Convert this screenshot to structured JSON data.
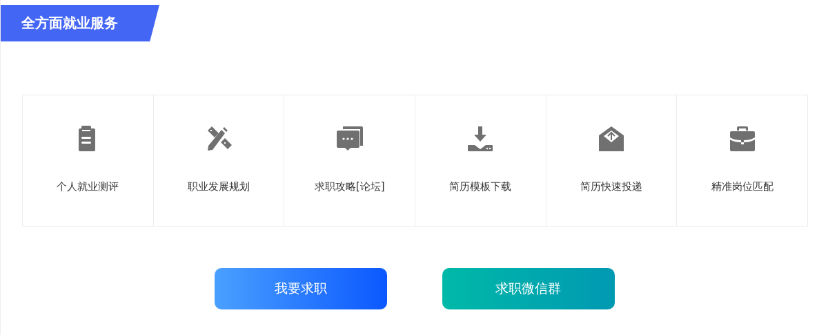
{
  "section_title": "全方面就业服务",
  "services": [
    {
      "label": "个人就业测评"
    },
    {
      "label": "职业发展规划"
    },
    {
      "label": "求职攻略[论坛]"
    },
    {
      "label": "简历模板下载"
    },
    {
      "label": "简历快速投递"
    },
    {
      "label": "精准岗位匹配"
    }
  ],
  "buttons": [
    {
      "label": "我要求职",
      "kind": "blue"
    },
    {
      "label": "求职微信群",
      "kind": "teal"
    }
  ]
}
